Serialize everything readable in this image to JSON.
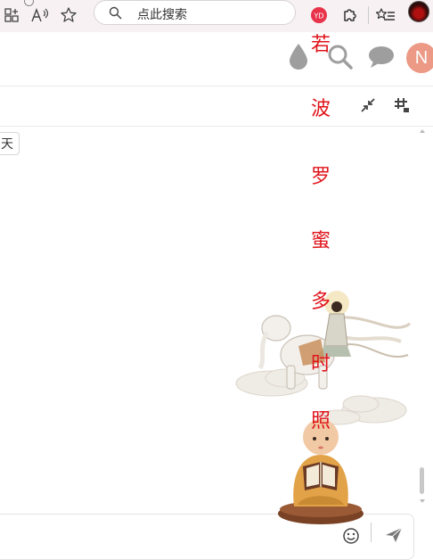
{
  "browser": {
    "search_placeholder": "点此搜索",
    "icons": [
      "apps-icon",
      "read-aloud-icon",
      "favorite-star-icon",
      "search-icon",
      "extension-badge-icon",
      "extensions-puzzle-icon",
      "favorites-list-icon",
      "profile-avatar-icon"
    ],
    "badge_text": "YD"
  },
  "header": {
    "icons": [
      "water-drop-icon",
      "search-icon",
      "chat-bubble-icon"
    ],
    "user_initial": "N"
  },
  "subbar": {
    "icons": [
      "collapse-arrows-icon",
      "hashtag-grid-icon"
    ]
  },
  "chat": {
    "tag_label": "天"
  },
  "overlay": {
    "verse_chars": [
      "若",
      "波",
      "罗",
      "蜜",
      "多",
      "时",
      "照"
    ],
    "verse_color": "#e0141b"
  },
  "input": {
    "icons": [
      "emoji-icon",
      "send-icon"
    ]
  }
}
